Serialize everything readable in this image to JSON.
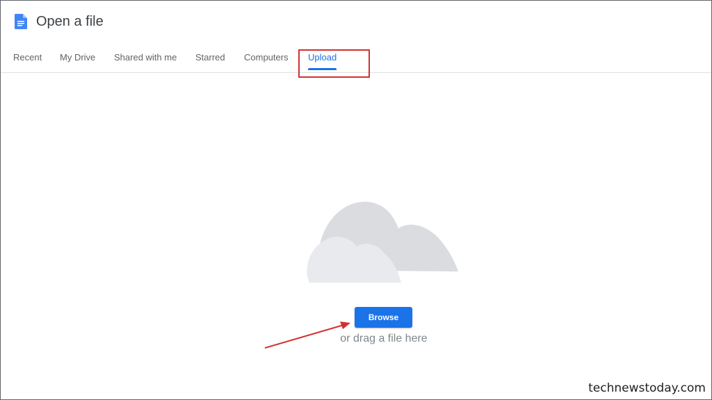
{
  "dialog": {
    "title": "Open a file"
  },
  "tabs": [
    {
      "label": "Recent",
      "active": false
    },
    {
      "label": "My Drive",
      "active": false
    },
    {
      "label": "Shared with me",
      "active": false
    },
    {
      "label": "Starred",
      "active": false
    },
    {
      "label": "Computers",
      "active": false
    },
    {
      "label": "Upload",
      "active": true
    }
  ],
  "upload": {
    "browse_label": "Browse",
    "drag_hint": "or drag a file here"
  },
  "watermark": {
    "text": "technewstoday.com"
  },
  "icons": {
    "logo": "google-docs-icon",
    "illustration": "cloud-icon",
    "annotation": "red-arrow"
  },
  "colors": {
    "accent": "#1a73e8",
    "annotation": "#d32f2f",
    "cloud_back": "#dadce0",
    "cloud_front": "#e8eaed"
  }
}
